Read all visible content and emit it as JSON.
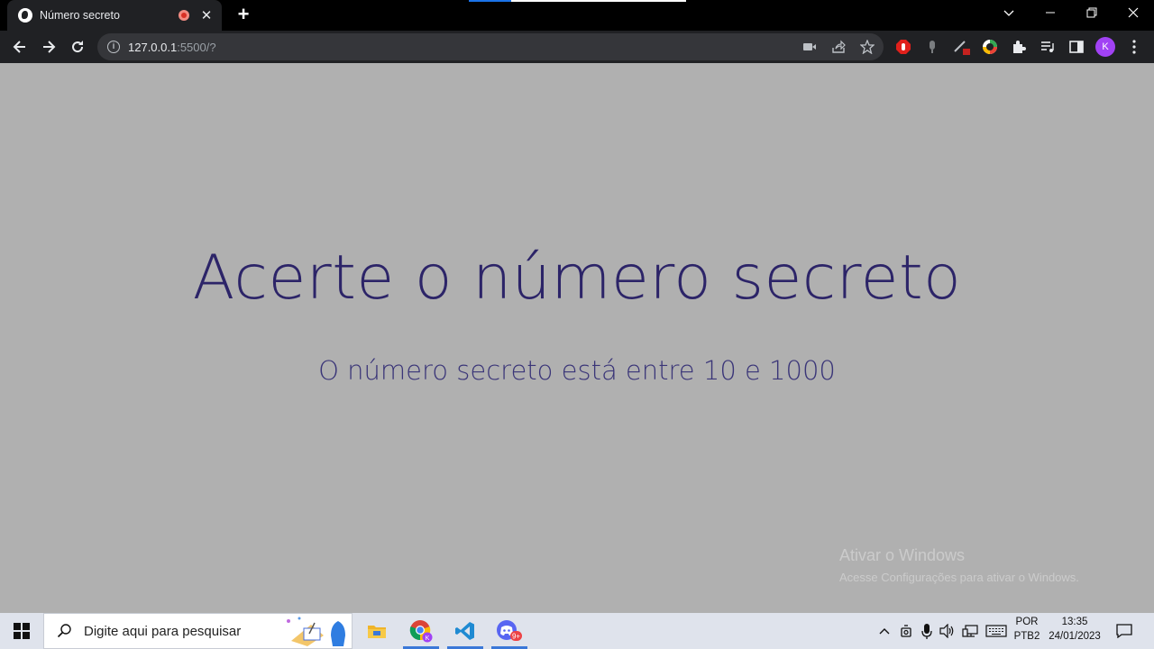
{
  "browser": {
    "tab_title": "Número secreto",
    "url_host": "127.0.0.1",
    "url_path": ":5500/?",
    "profile_initial": "K"
  },
  "page": {
    "headline": "Acerte o número secreto",
    "subline": "O número secreto está entre 10 e 1000"
  },
  "watermark": {
    "line1": "Ativar o Windows",
    "line2": "Acesse Configurações para ativar o Windows."
  },
  "taskbar": {
    "search_placeholder": "Digite aqui para pesquisar",
    "language_line1": "POR",
    "language_line2": "PTB2",
    "time": "13:35",
    "date": "24/01/2023",
    "chrome_badge": "K",
    "discord_badge": "9+"
  },
  "colors": {
    "page_background": "#b0b0b0",
    "headline": "#2c2468",
    "browser_frame": "#202124"
  }
}
